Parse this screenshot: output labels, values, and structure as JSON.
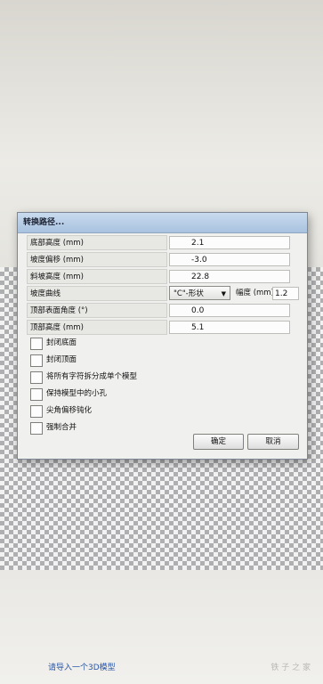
{
  "dialog": {
    "title": "转换路径...",
    "fields": [
      {
        "label": "底部高度 (mm)",
        "value": "2.1"
      },
      {
        "label": "坡度偏移 (mm)",
        "value": "-3.0"
      },
      {
        "label": "斜坡高度 (mm)",
        "value": "22.8"
      }
    ],
    "slope_curve": {
      "label": "坡度曲线",
      "selected": "\"C\"-形状",
      "width_label": "幅度 (mm)",
      "width_value": "1.2"
    },
    "fields2": [
      {
        "label": "顶部表面角度 (°)",
        "value": "0.0"
      },
      {
        "label": "顶部高度 (mm)",
        "value": "5.1"
      }
    ],
    "checkboxes": [
      {
        "label": "封闭底面",
        "checked": false
      },
      {
        "label": "封闭顶面",
        "checked": false
      },
      {
        "label": "将所有字符拆分成单个模型",
        "checked": false
      },
      {
        "label": "保持模型中的小孔",
        "checked": false
      },
      {
        "label": "尖角偏移钝化",
        "checked": false
      },
      {
        "label": "强制合并",
        "checked": false
      }
    ],
    "ok_label": "确定",
    "cancel_label": "取消"
  },
  "footer": {
    "import_text": "请导入一个3D模型",
    "watermark": "铁 子 之 家"
  }
}
